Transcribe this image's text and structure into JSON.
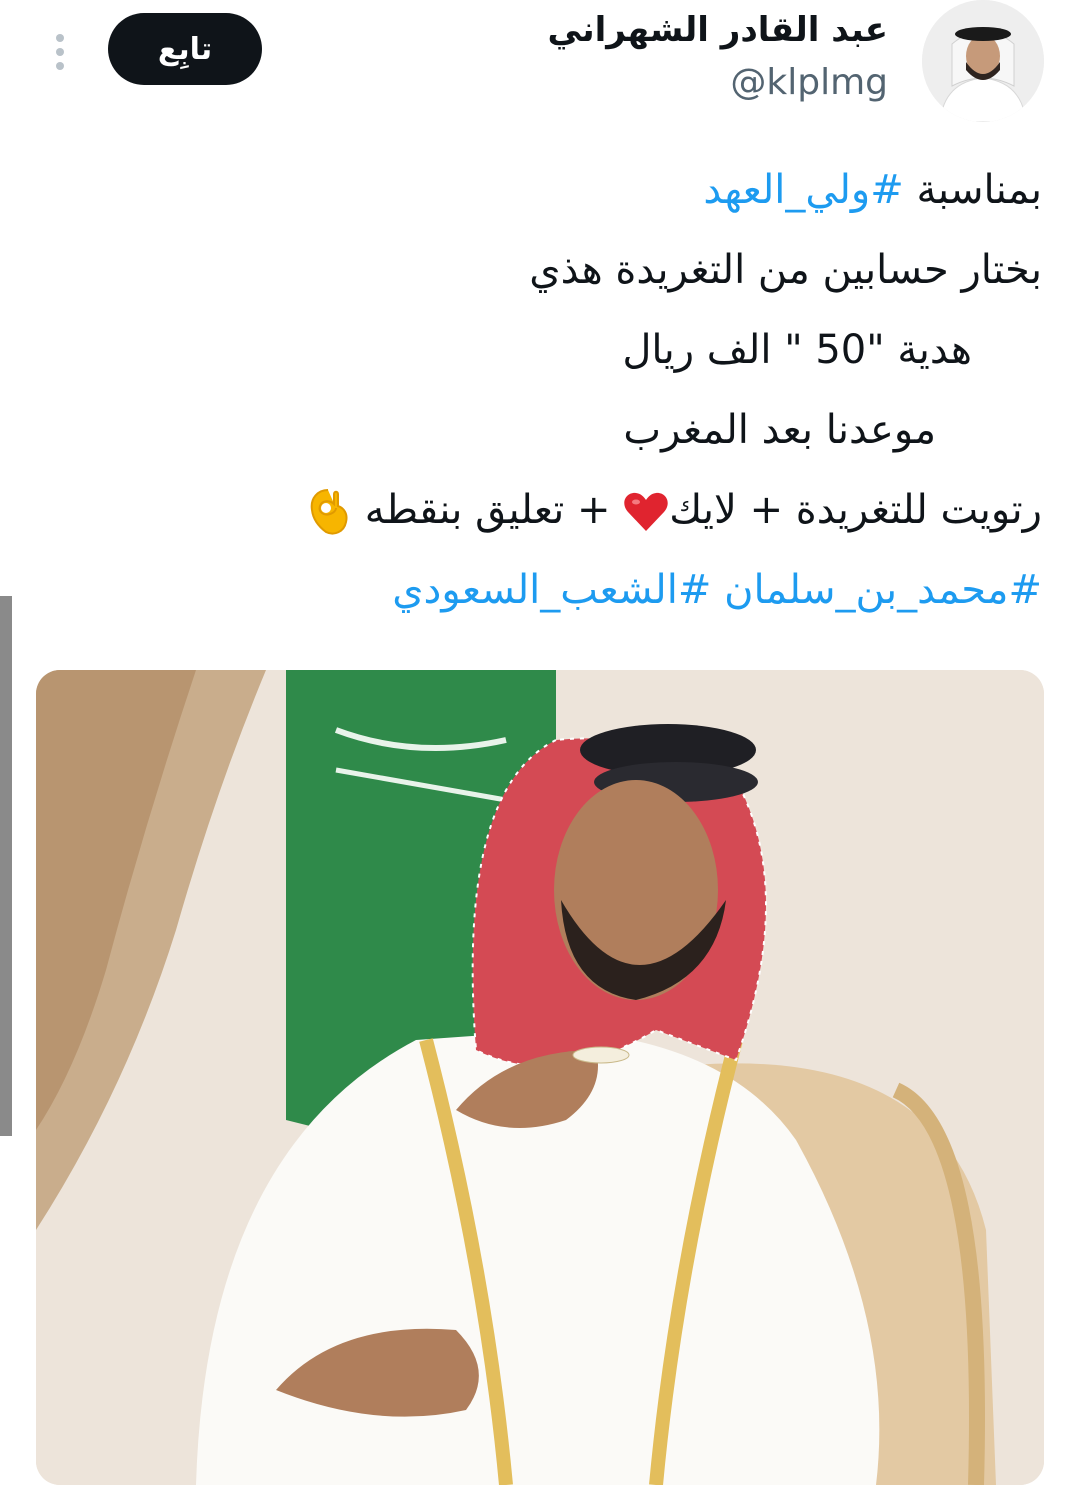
{
  "user": {
    "display_name": "عبد القادر الشهراني",
    "handle": "@klplmg",
    "follow_label": "تابِع"
  },
  "tweet": {
    "line1_text": "بمناسبة ",
    "line1_hashtag": "#ولي_العهد",
    "line2": "بختار حسابين من التغريدة هذي",
    "line3": "هدية \"50 \" الف ريال",
    "line4": "موعدنا بعد المغرب",
    "line5_a": "رتويت للتغريدة + لايك",
    "line5_b": " + تعليق بنقطه ",
    "hashtag_a": "#محمد_بن_سلمان",
    "hashtag_b": "#الشعب_السعودي"
  },
  "icons": {
    "more": "more-vertical-icon",
    "heart": "red-heart-emoji",
    "ok_hand": "ok-hand-emoji"
  },
  "colors": {
    "hashtag": "#1d9bf0",
    "follow_bg": "#0f1419",
    "handle": "#536471",
    "flag_green": "#2f8a4a"
  }
}
